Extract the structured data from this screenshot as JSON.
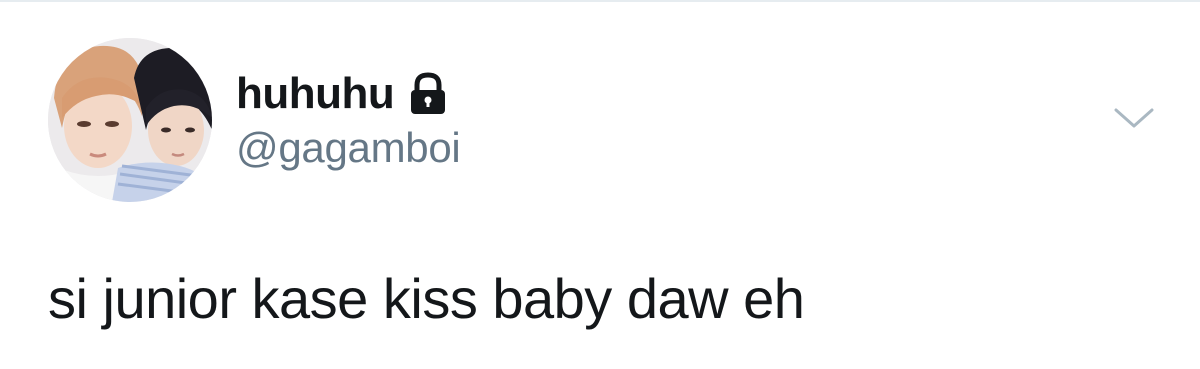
{
  "tweet": {
    "author": {
      "display_name": "huhuhu",
      "handle": "@gagamboi",
      "protected": true,
      "avatar": "avatar-photo-two-people"
    },
    "text": "si junior kase kiss baby daw eh",
    "menu_icon": "chevron-down-icon",
    "lock_icon": "lock-icon"
  },
  "colors": {
    "text_primary": "#14171a",
    "text_secondary": "#657786",
    "caret": "#aab8c2",
    "divider": "#e6ecf0"
  }
}
